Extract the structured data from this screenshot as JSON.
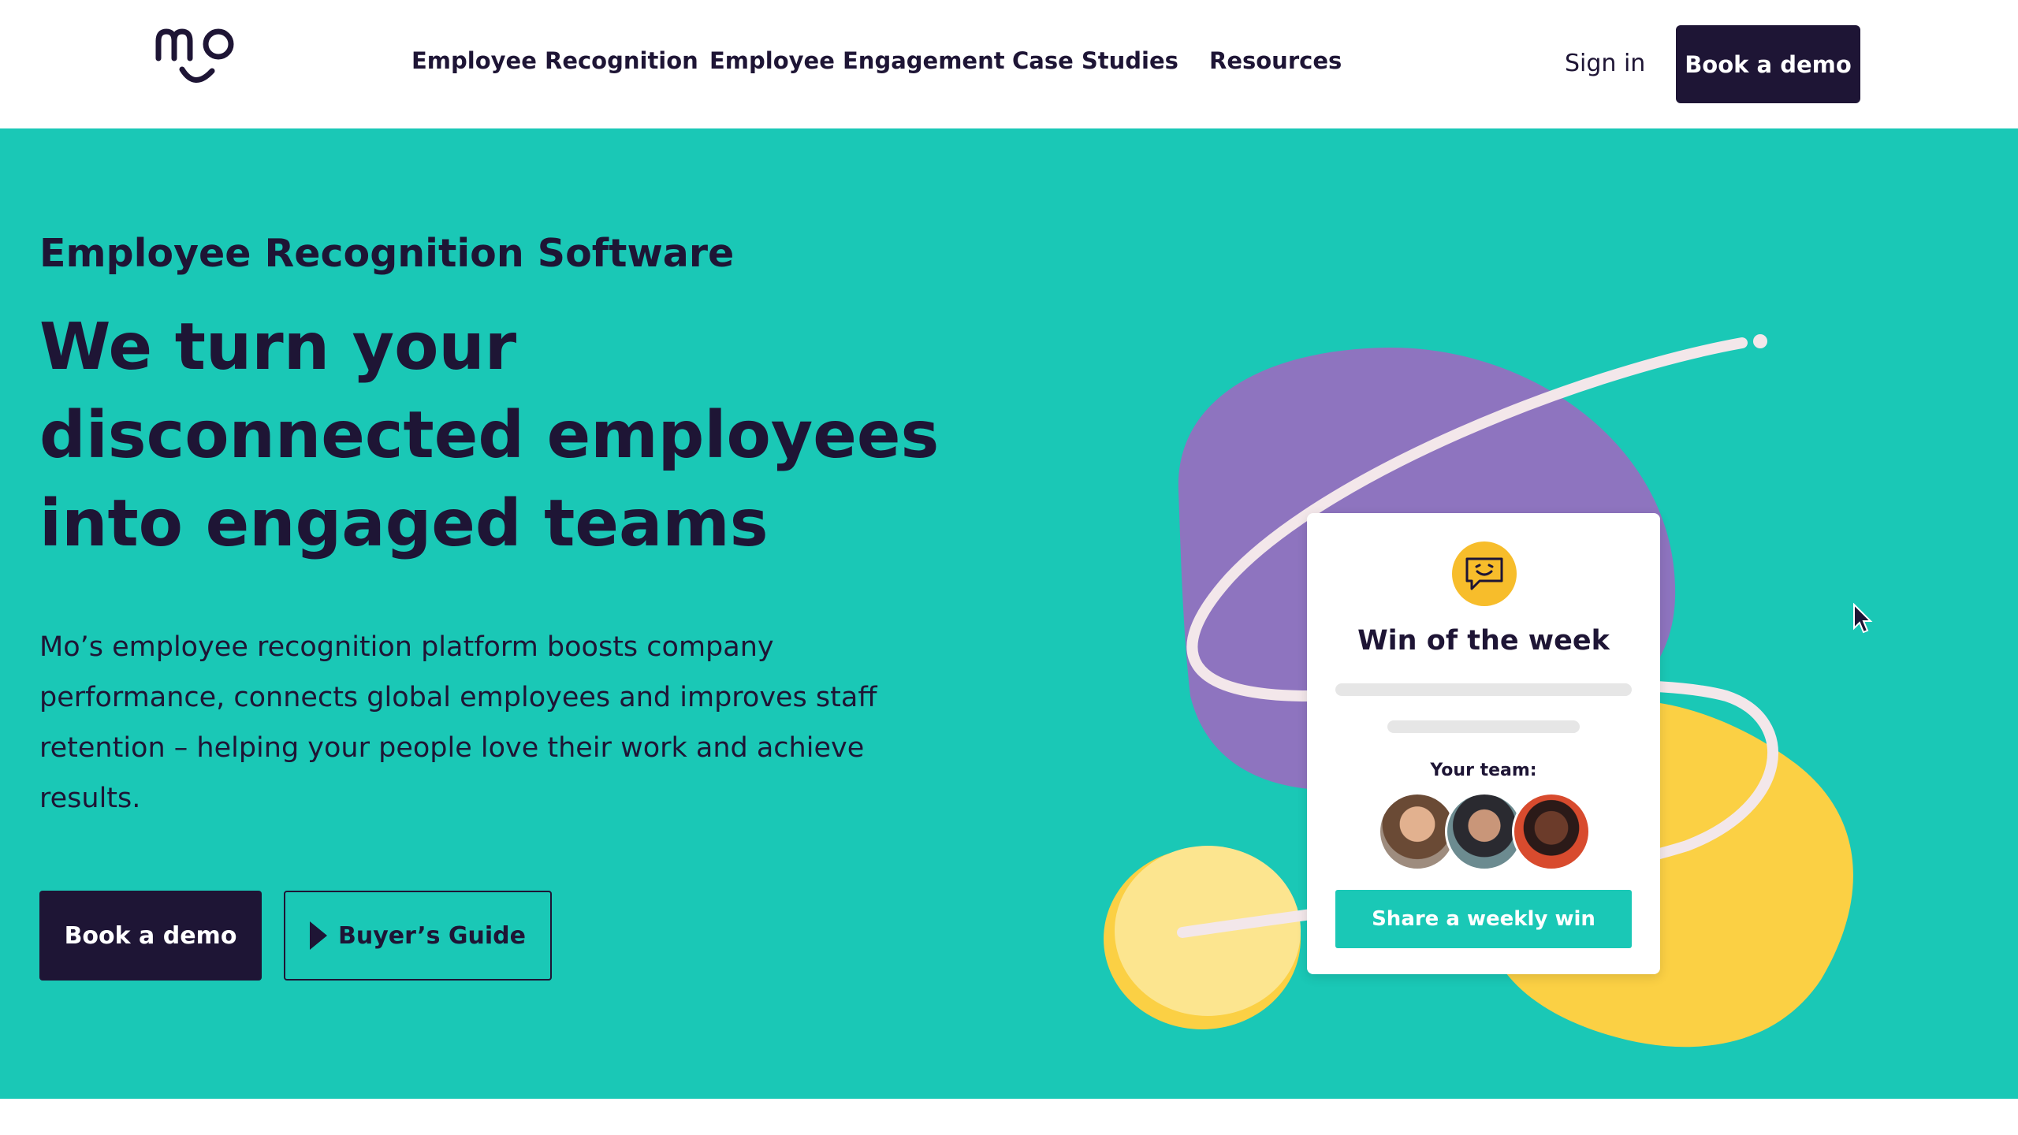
{
  "header": {
    "logo_alt": "mo",
    "nav": [
      {
        "label": "Employee Recognition"
      },
      {
        "label": "Employee Engagement"
      },
      {
        "label": "Case Studies"
      },
      {
        "label": "Resources"
      }
    ],
    "signin_label": "Sign in",
    "demo_label": "Book a demo"
  },
  "hero": {
    "eyebrow": "Employee Recognition Software",
    "headline": "We turn your disconnected employees into engaged teams",
    "body": "Mo’s employee recognition platform boosts company performance, connects global employees and improves staff retention – helping your people love their work and achieve results.",
    "primary_cta": "Book a demo",
    "secondary_cta": "Buyer’s Guide"
  },
  "card": {
    "icon": "chat-smile-icon",
    "title": "Win of the week",
    "team_label": "Your team:",
    "cta": "Share a weekly win"
  },
  "colors": {
    "teal": "#1ac8b6",
    "navy": "#1e1535",
    "purple": "#8e74bf",
    "yellow": "#fbd044",
    "light_yellow": "#fce58f"
  }
}
